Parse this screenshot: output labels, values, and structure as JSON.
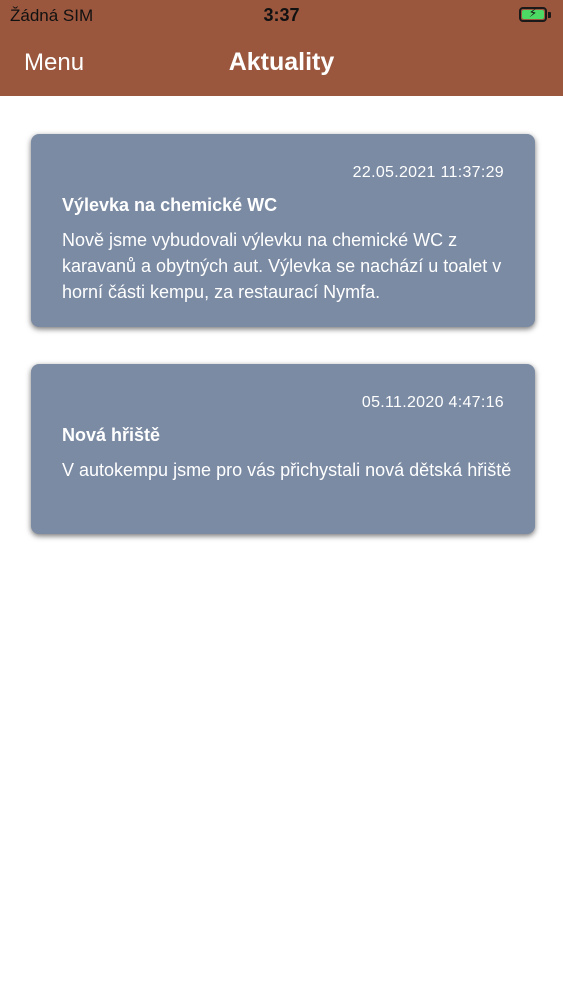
{
  "status_bar": {
    "carrier": "Žádná SIM",
    "time": "3:37",
    "battery_state": "charging",
    "battery_color": "#4cd964"
  },
  "nav": {
    "menu_label": "Menu",
    "title": "Aktuality",
    "background_color": "#9a573e"
  },
  "news": [
    {
      "date": "22.05.2021 11:37:29",
      "title": "Výlevka na chemické WC",
      "body": "Nově jsme vybudovali výlevku na chemické WC z karavanů a obytných aut. Výlevka se nachází u toalet v horní části kempu, za restaurací Nymfa."
    },
    {
      "date": "05.11.2020 4:47:16",
      "title": "Nová hřiště",
      "body": "V autokempu jsme pro vás přichystali nová dětská hřiště"
    }
  ],
  "card_color": "#7b8ba3"
}
